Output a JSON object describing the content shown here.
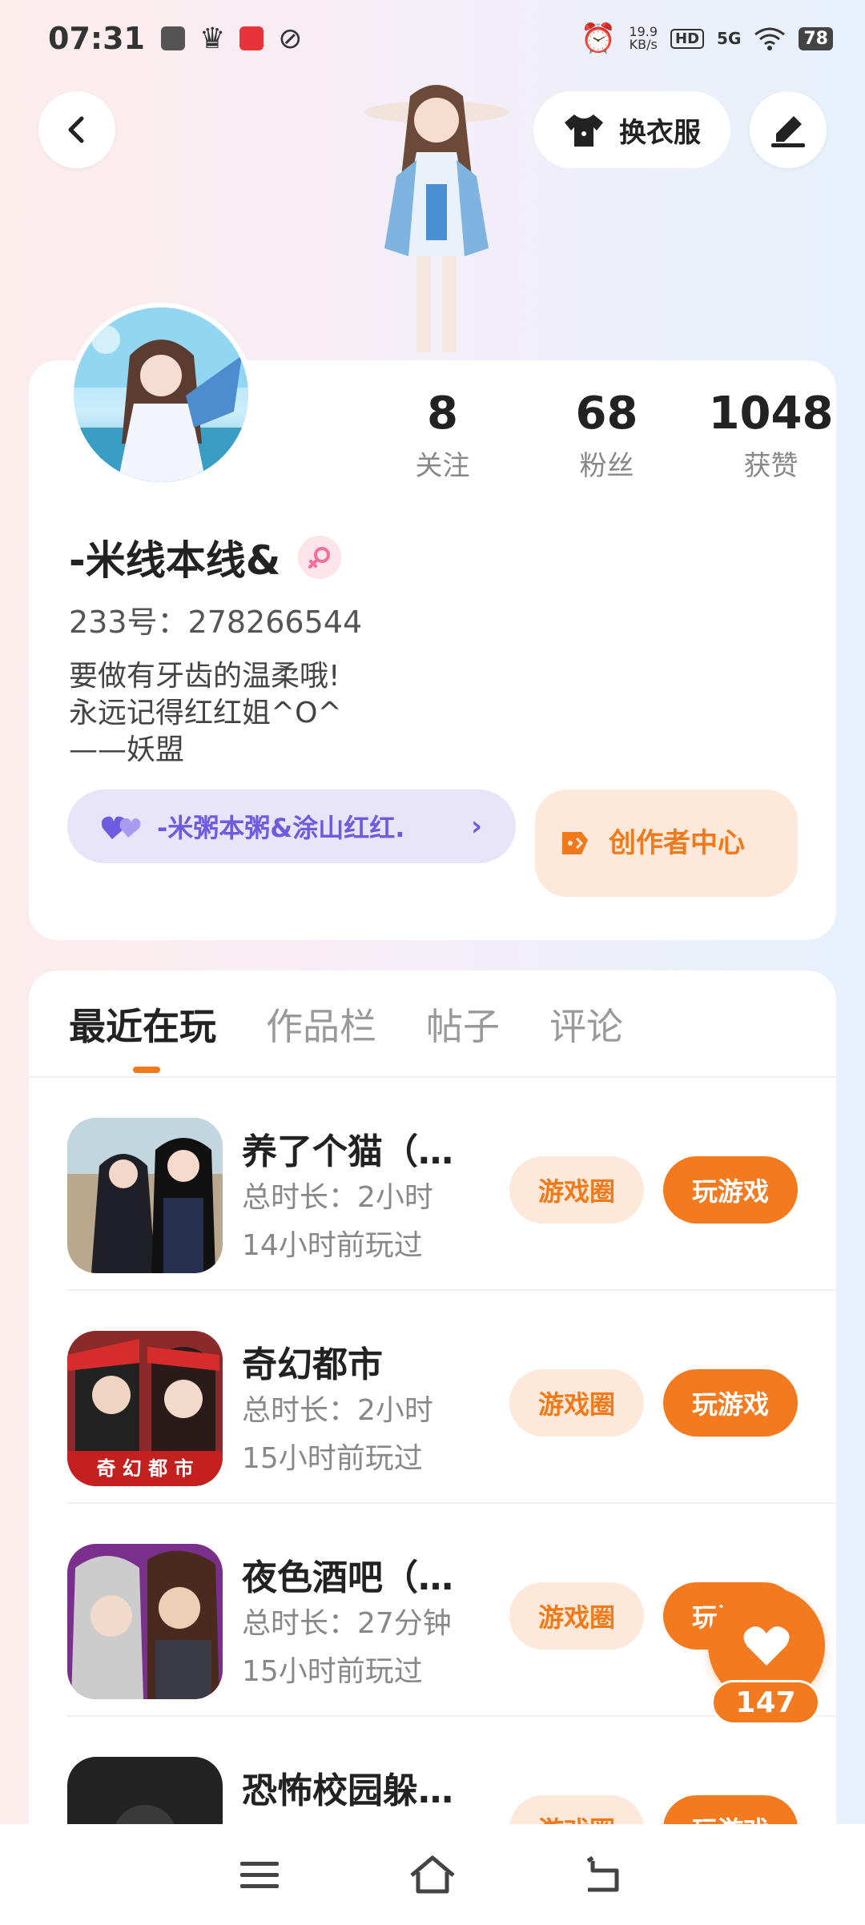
{
  "status_bar": {
    "time": "07:31",
    "net_speed": "19.9",
    "net_unit": "KB/s",
    "hd": "HD",
    "signal": "5G",
    "battery": "78"
  },
  "header": {
    "change_outfit_label": "换衣服"
  },
  "profile": {
    "stats": [
      {
        "value": "8",
        "label": "关注"
      },
      {
        "value": "68",
        "label": "粉丝"
      },
      {
        "value": "1048",
        "label": "获赞"
      }
    ],
    "name": "-米线本线&",
    "uid": "233号：278266544",
    "bio": [
      "要做有牙齿的温柔哦!",
      "永远记得红红姐^O^",
      "——妖盟"
    ],
    "family_label": "-米粥本粥&涂山红红.",
    "creator_label": "创作者中心"
  },
  "tabs": [
    "最近在玩",
    "作品栏",
    "帖子",
    "评论"
  ],
  "games": [
    {
      "title": "养了个猫（…",
      "duration": "总时长：2小时",
      "last_played": "14小时前玩过",
      "circle_label": "游戏圈",
      "play_label": "玩游戏"
    },
    {
      "title": "奇幻都市",
      "duration": "总时长：2小时",
      "last_played": "15小时前玩过",
      "circle_label": "游戏圈",
      "play_label": "玩游戏",
      "thumb_text": "奇 幻 都 市"
    },
    {
      "title": "夜色酒吧（…",
      "duration": "总时长：27分钟",
      "last_played": "15小时前玩过",
      "circle_label": "游戏圈",
      "play_label": "玩游戏"
    },
    {
      "title": "恐怖校园躲…",
      "duration": "",
      "last_played": "",
      "circle_label": "游戏圈",
      "play_label": "玩游戏"
    }
  ],
  "like_count": "147",
  "colors": {
    "accent": "#f47a20",
    "family": "#6d5be0"
  }
}
